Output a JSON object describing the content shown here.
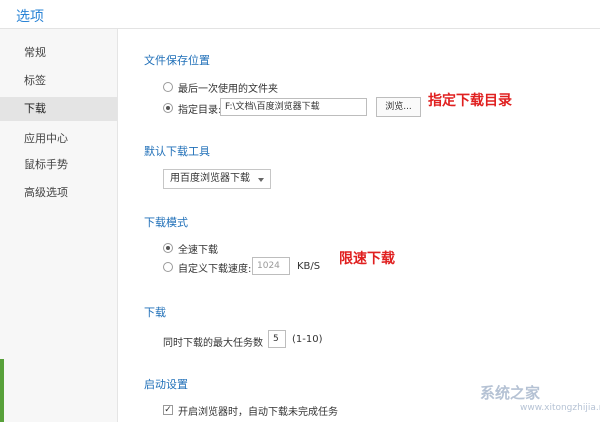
{
  "window": {
    "title": "选项"
  },
  "sidebar": {
    "items": [
      {
        "label": "常规"
      },
      {
        "label": "标签"
      },
      {
        "label": "下载"
      },
      {
        "label": "应用中心"
      },
      {
        "label": "鼠标手势"
      },
      {
        "label": "高级选项"
      }
    ],
    "selected": "下载"
  },
  "save_location": {
    "heading": "文件保存位置",
    "option_last": "最后一次使用的文件夹",
    "option_specify": "指定目录:",
    "path_value": "F:\\文档\\百度浏览器下载",
    "browse_label": "浏览...",
    "selected": "指定目录:"
  },
  "download_tool": {
    "heading": "默认下载工具",
    "selected_value": "用百度浏览器下载"
  },
  "download_mode": {
    "heading": "下载模式",
    "option_full": "全速下载",
    "option_custom": "自定义下载速度:",
    "speed_value": "1024",
    "speed_unit": "KB/S",
    "selected": "全速下载"
  },
  "download": {
    "heading": "下载",
    "max_tasks_label": "同时下载的最大任务数",
    "max_tasks_value": "5",
    "max_tasks_range": "(1-10)"
  },
  "startup": {
    "heading": "启动设置",
    "auto_resume_label": "开启浏览器时，自动下载未完成任务",
    "auto_resume_checked": true
  },
  "annotations": {
    "specify_dir": "指定下载目录",
    "limit_speed": "限速下载"
  },
  "watermark": {
    "text": "系统之家",
    "url": "www.xitongzhijia.net"
  },
  "colors": {
    "accent_blue": "#2a84d6",
    "section_blue": "#1f6fb8",
    "annotation_red": "#e02020",
    "sidebar_accent_green": "#58a13a"
  }
}
